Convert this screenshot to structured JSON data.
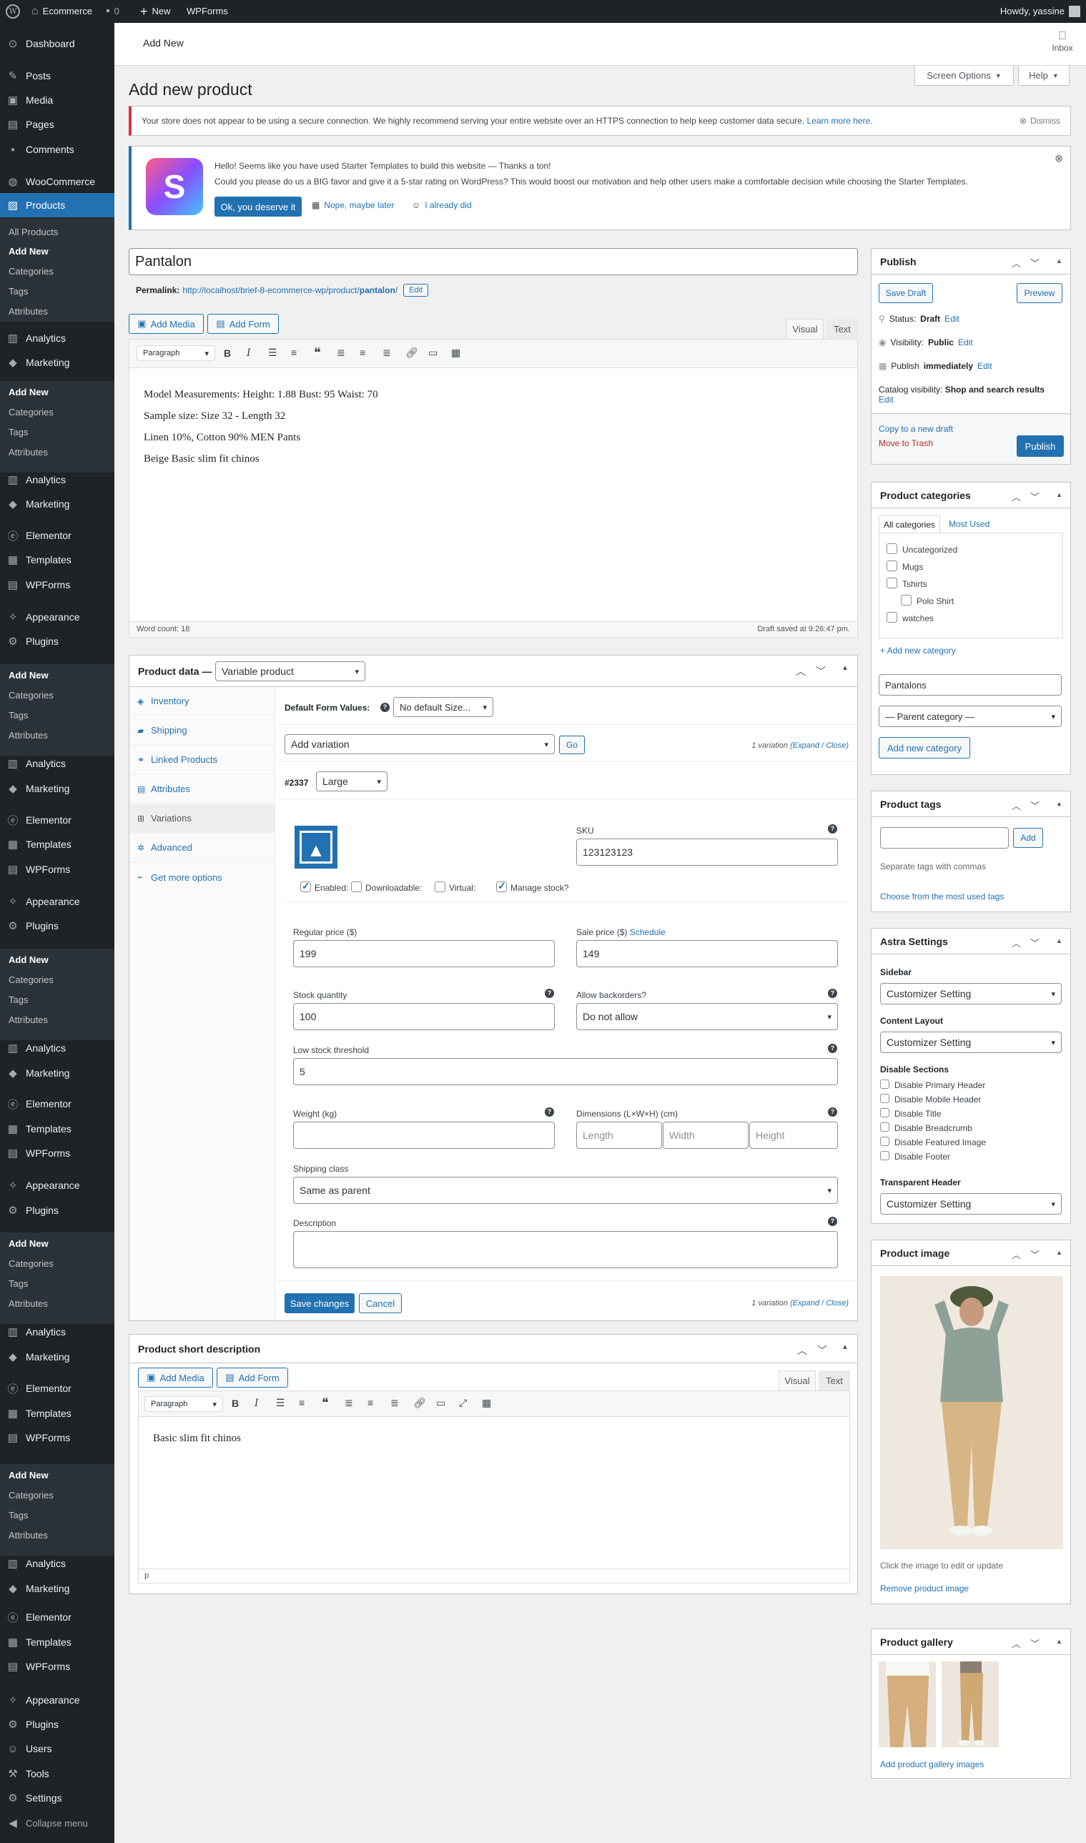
{
  "adminbar": {
    "site": "Ecommerce",
    "comments": "0",
    "new": "New",
    "wpforms": "WPForms",
    "howdy": "Howdy, yassine"
  },
  "sidebar": {
    "top": [
      "Dashboard",
      "Posts",
      "Media",
      "Pages",
      "Comments",
      "WooCommerce",
      "Products"
    ],
    "products_sub": [
      "All Products",
      "Add New",
      "Categories",
      "Tags",
      "Attributes"
    ],
    "analytics": "Analytics",
    "marketing": "Marketing",
    "sub_add": "Add New",
    "sub_cat": "Categories",
    "sub_tags": "Tags",
    "sub_attr": "Attributes",
    "elementor": "Elementor",
    "templates": "Templates",
    "wpforms": "WPForms",
    "appearance": "Appearance",
    "plugins": "Plugins",
    "users": "Users",
    "tools": "Tools",
    "settings": "Settings",
    "collapse": "Collapse menu"
  },
  "header": {
    "title": "Add New",
    "inbox": "Inbox"
  },
  "page": {
    "title": "Add new product",
    "screen_options": "Screen Options",
    "help": "Help"
  },
  "notice": {
    "text": "Your store does not appear to be using a secure connection. We highly recommend serving your entire website over an HTTPS connection to help keep customer data secure.",
    "link": "Learn more here.",
    "dismiss": "Dismiss"
  },
  "starter": {
    "line1": "Hello! Seems like you have used Starter Templates to build this website — Thanks a ton!",
    "line2": "Could you please do us a BIG favor and give it a 5-star rating on WordPress? This would boost our motivation and help other users make a comfortable decision while choosing the Starter Templates.",
    "btn_yes": "Ok, you deserve it",
    "btn_later": "Nope, maybe later",
    "btn_did": "I already did"
  },
  "product": {
    "title": "Pantalon",
    "permalink_label": "Permalink:",
    "permalink_base": "http://localhost/brief-8-ecommerce-wp/product/",
    "permalink_slug": "pantalon",
    "permalink_end": "/",
    "edit": "Edit"
  },
  "editor": {
    "add_media": "Add Media",
    "add_form": "Add Form",
    "visual": "Visual",
    "text": "Text",
    "format": "Paragraph",
    "lines": [
      "Model Measurements: Height: 1.88 Bust: 95 Waist: 70",
      "Sample size: Size 32 - Length 32",
      "Linen 10%, Cotton 90% MEN Pants",
      "Beige Basic slim fit chinos"
    ],
    "word_count": "Word count: 18",
    "draft_saved": "Draft saved at 9:26:47 pm."
  },
  "product_data": {
    "label": "Product data —",
    "type": "Variable product",
    "tabs": [
      "Inventory",
      "Shipping",
      "Linked Products",
      "Attributes",
      "Variations",
      "Advanced",
      "Get more options"
    ],
    "default_form": "Default Form Values:",
    "default_sel": "No default Size...",
    "add_variation": "Add variation",
    "go": "Go",
    "count": "1 variation",
    "expand": "(Expand / Close)",
    "var_id": "#2337",
    "var_size": "Large",
    "sku_label": "SKU",
    "sku": "123123123",
    "enabled": "Enabled:",
    "downloadable": "Downloadable:",
    "virtual": "Virtual:",
    "manage_stock": "Manage stock?",
    "regular_label": "Regular price ($)",
    "regular": "199",
    "sale_label": "Sale price ($)",
    "schedule": "Schedule",
    "sale": "149",
    "stock_label": "Stock quantity",
    "stock": "100",
    "backorders_label": "Allow backorders?",
    "backorders": "Do not allow",
    "low_label": "Low stock threshold",
    "low": "5",
    "weight_label": "Weight (kg)",
    "dim_label": "Dimensions (L×W×H) (cm)",
    "length": "Length",
    "width": "Width",
    "height": "Height",
    "ship_label": "Shipping class",
    "ship": "Same as parent",
    "desc_label": "Description",
    "save": "Save changes",
    "cancel": "Cancel"
  },
  "short_desc": {
    "title": "Product short description",
    "text": "Basic slim fit chinos",
    "path": "p"
  },
  "publish": {
    "title": "Publish",
    "save_draft": "Save Draft",
    "preview": "Preview",
    "status_l": "Status:",
    "status": "Draft",
    "vis_l": "Visibility:",
    "vis": "Public",
    "pub_l": "Publish",
    "pub": "immediately",
    "cat_l": "Catalog visibility:",
    "cat": "Shop and search results",
    "edit": "Edit",
    "copy": "Copy to a new draft",
    "trash": "Move to Trash",
    "publish": "Publish"
  },
  "categories": {
    "title": "Product categories",
    "tab_all": "All categories",
    "tab_most": "Most Used",
    "items": [
      "Uncategorized",
      "Mugs",
      "Tshirts",
      "Polo Shirt",
      "watches"
    ],
    "add_link": "+ Add new category",
    "new_value": "Pantalons",
    "parent": "— Parent category —",
    "add_btn": "Add new category"
  },
  "tags": {
    "title": "Product tags",
    "add": "Add",
    "hint": "Separate tags with commas",
    "choose": "Choose from the most used tags"
  },
  "astra": {
    "title": "Astra Settings",
    "sidebar_l": "Sidebar",
    "sidebar": "Customizer Setting",
    "content_l": "Content Layout",
    "content": "Customizer Setting",
    "disable_l": "Disable Sections",
    "disables": [
      "Disable Primary Header",
      "Disable Mobile Header",
      "Disable Title",
      "Disable Breadcrumb",
      "Disable Featured Image",
      "Disable Footer"
    ],
    "transparent_l": "Transparent Header",
    "transparent": "Customizer Setting"
  },
  "image": {
    "title": "Product image",
    "hint": "Click the image to edit or update",
    "remove": "Remove product image"
  },
  "gallery": {
    "title": "Product gallery",
    "add": "Add product gallery images"
  },
  "colors": {
    "accent": "#2271b1",
    "dark": "#1d2327",
    "sub": "#2c3338",
    "notice_pink": "#d63638"
  }
}
